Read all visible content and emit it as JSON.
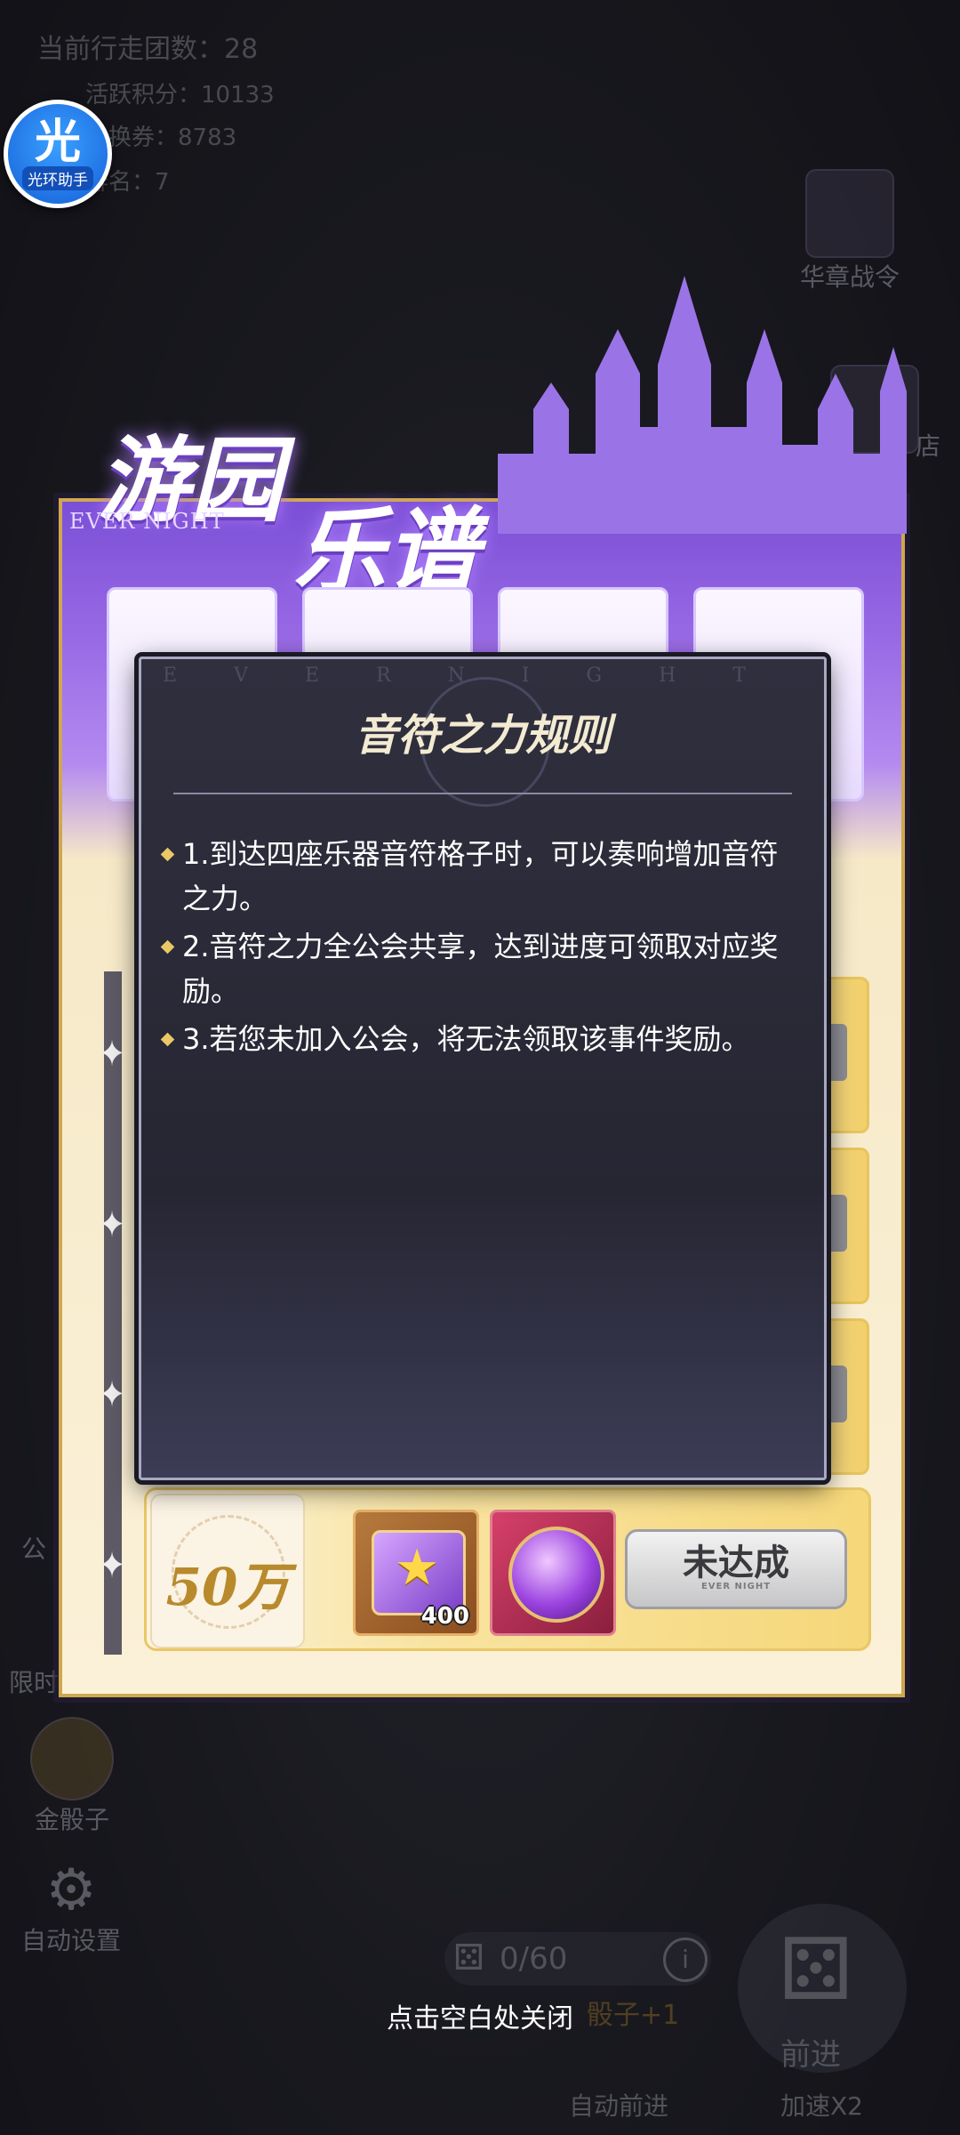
{
  "hud": {
    "steps": "当前行走团数：28",
    "score": "活跃积分：10133",
    "exchange": "兑换券：8783",
    "rank": "排名：7"
  },
  "assistant": {
    "glyph": "光",
    "label": "光环助手"
  },
  "side": {
    "pass_label": "华章战令",
    "shop_label": "店",
    "guild_label": "公",
    "limit_label": "限时",
    "gold_dice_label": "金骰子",
    "auto_settings_label": "自动设置"
  },
  "bottom": {
    "dice_count": "0/60",
    "dice_bonus": "骰子+1",
    "forward_label": "前进",
    "auto_forward_label": "自动前进",
    "speed_label": "加速X2"
  },
  "panel": {
    "title_line1": "游园",
    "title_line2": "乐谱",
    "subtitle": "EVER NIGHT",
    "reward_row": {
      "threshold": "50万",
      "item1_count": "400",
      "button_label": "未达成",
      "button_sub": "EVER NIGHT"
    }
  },
  "modal": {
    "deco": "EVERNIGHT",
    "title": "音符之力规则",
    "rules": [
      "1.到达四座乐器音符格子时，可以奏响增加音符之力。",
      "2.音符之力全公会共享，达到进度可领取对应奖励。",
      "3.若您未加入公会，将无法领取该事件奖励。"
    ]
  },
  "close_hint": "点击空白处关闭"
}
